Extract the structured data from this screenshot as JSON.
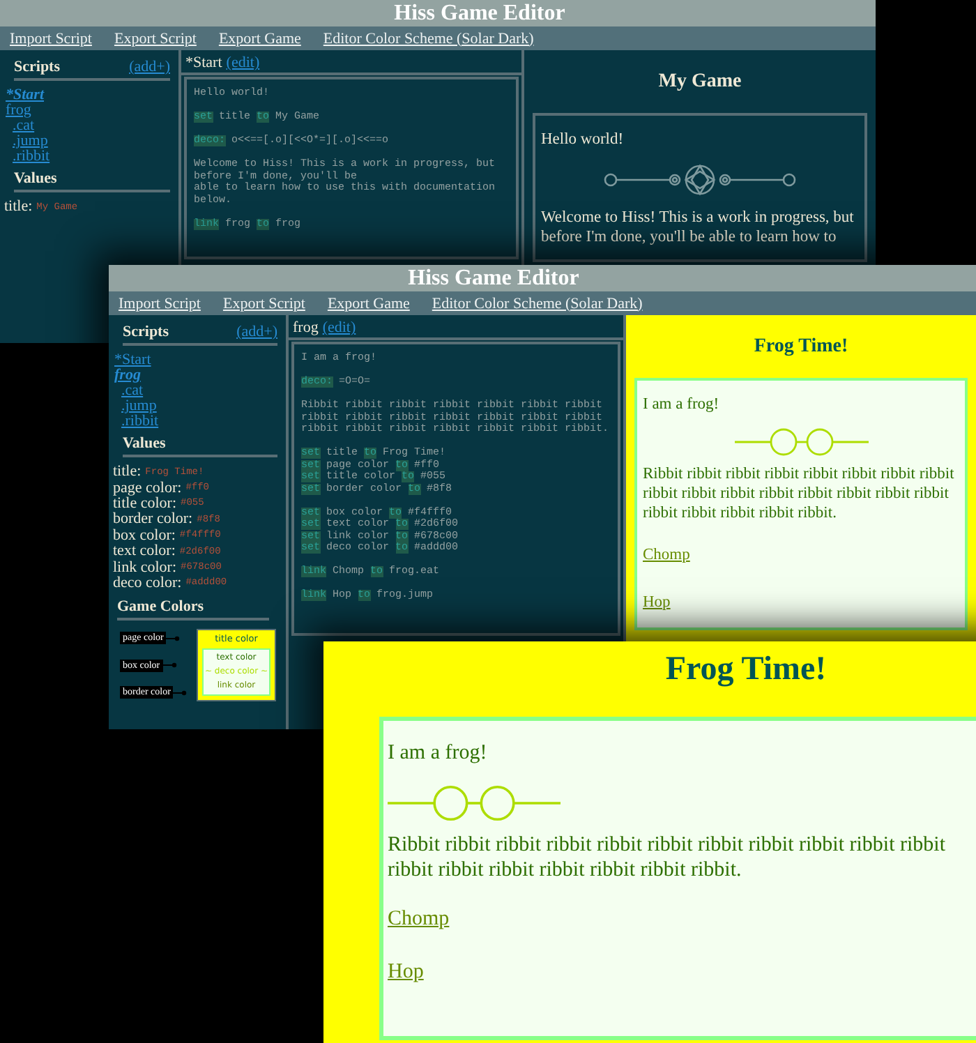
{
  "windows": [
    {
      "kind": "editor",
      "title": "Hiss Game Editor",
      "menu": [
        "Import Script",
        "Export Script",
        "Export Game",
        "Editor Color Scheme (Solar Dark)"
      ],
      "sidebar": {
        "scripts_header": "Scripts",
        "add_link": "(add+)",
        "scripts": [
          {
            "label": "*Start",
            "selected": true
          },
          {
            "label": "frog",
            "selected": false,
            "children": [
              {
                "label": ".cat",
                "selected": false
              },
              {
                "label": ".jump",
                "selected": false
              },
              {
                "label": ".ribbit",
                "selected": false
              }
            ]
          }
        ],
        "values_header": "Values",
        "values": [
          {
            "label": "title:",
            "value": "My Game"
          }
        ]
      },
      "editor": {
        "script_name": "*Start",
        "edit_link": "(edit)",
        "blocks": [
          [
            [
              {
                "text": "Hello world!",
                "keyword": false
              }
            ]
          ],
          [
            [
              {
                "text": "set",
                "keyword": true
              },
              {
                "text": " title ",
                "keyword": false
              },
              {
                "text": "to",
                "keyword": true
              },
              {
                "text": " My Game",
                "keyword": false
              }
            ]
          ],
          [
            [
              {
                "text": "deco:",
                "keyword": true
              },
              {
                "text": " o<<==[.o][<<O*=][.o]<<==o",
                "keyword": false
              }
            ]
          ],
          [
            [
              {
                "text": "Welcome to Hiss! This is a work in progress, but",
                "keyword": false
              }
            ],
            [
              {
                "text": "before I'm done, you'll be",
                "keyword": false
              }
            ],
            [
              {
                "text": "able to learn how to use this with documentation",
                "keyword": false
              }
            ],
            [
              {
                "text": "below.",
                "keyword": false
              }
            ]
          ],
          [
            [
              {
                "text": "link",
                "keyword": true
              },
              {
                "text": " frog ",
                "keyword": false
              },
              {
                "text": "to",
                "keyword": true
              },
              {
                "text": " frog",
                "keyword": false
              }
            ]
          ]
        ]
      },
      "preview": {
        "kind": "dark",
        "title": "My Game",
        "items": [
          {
            "kind": "text",
            "lines": [
              "Hello world!"
            ]
          },
          {
            "kind": "ornate-divider"
          },
          {
            "kind": "text",
            "lines": [
              "Welcome to Hiss! This is a work in progress, but",
              "before I'm done, you'll be able to learn how to"
            ]
          }
        ]
      }
    },
    {
      "kind": "editor",
      "title": "Hiss Game Editor",
      "menu": [
        "Import Script",
        "Export Script",
        "Export Game",
        "Editor Color Scheme (Solar Dark)"
      ],
      "sidebar": {
        "scripts_header": "Scripts",
        "add_link": "(add+)",
        "scripts": [
          {
            "label": "*Start",
            "selected": false
          },
          {
            "label": "frog",
            "selected": true,
            "children": [
              {
                "label": ".cat",
                "selected": false
              },
              {
                "label": ".jump",
                "selected": false
              },
              {
                "label": ".ribbit",
                "selected": false
              }
            ]
          }
        ],
        "values_header": "Values",
        "values": [
          {
            "label": "title:",
            "value": "Frog Time!"
          },
          {
            "label": "page color:",
            "value": "#ff0"
          },
          {
            "label": "title color:",
            "value": "#055"
          },
          {
            "label": "border color:",
            "value": "#8f8"
          },
          {
            "label": "box color:",
            "value": "#f4fff0"
          },
          {
            "label": "text color:",
            "value": "#2d6f00"
          },
          {
            "label": "link color:",
            "value": "#678c00"
          },
          {
            "label": "deco color:",
            "value": "#addd00"
          }
        ],
        "game_colors": {
          "title": "Game Colors",
          "callouts": [
            "page color",
            "box color",
            "border color"
          ],
          "title_sample": "title color",
          "samples": [
            "text color",
            "~ deco color ~",
            "link color"
          ]
        }
      },
      "editor": {
        "script_name": "frog",
        "edit_link": "(edit)",
        "blocks": [
          [
            [
              {
                "text": "I am a frog!",
                "keyword": false
              }
            ]
          ],
          [
            [
              {
                "text": "deco:",
                "keyword": true
              },
              {
                "text": " =O=O=",
                "keyword": false
              }
            ]
          ],
          [
            [
              {
                "text": "Ribbit ribbit ribbit ribbit ribbit ribbit ribbit",
                "keyword": false
              }
            ],
            [
              {
                "text": "ribbit ribbit ribbit ribbit ribbit ribbit ribbit",
                "keyword": false
              }
            ],
            [
              {
                "text": "ribbit ribbit ribbit ribbit ribbit ribbit ribbit.",
                "keyword": false
              }
            ]
          ],
          [
            [
              {
                "text": "set",
                "keyword": true
              },
              {
                "text": " title ",
                "keyword": false
              },
              {
                "text": "to",
                "keyword": true
              },
              {
                "text": " Frog Time!",
                "keyword": false
              }
            ],
            [
              {
                "text": "set",
                "keyword": true
              },
              {
                "text": " page color ",
                "keyword": false
              },
              {
                "text": "to",
                "keyword": true
              },
              {
                "text": " #ff0",
                "keyword": false
              }
            ],
            [
              {
                "text": "set",
                "keyword": true
              },
              {
                "text": " title color ",
                "keyword": false
              },
              {
                "text": "to",
                "keyword": true
              },
              {
                "text": " #055",
                "keyword": false
              }
            ],
            [
              {
                "text": "set",
                "keyword": true
              },
              {
                "text": " border color ",
                "keyword": false
              },
              {
                "text": "to",
                "keyword": true
              },
              {
                "text": " #8f8",
                "keyword": false
              }
            ]
          ],
          [
            [
              {
                "text": "set",
                "keyword": true
              },
              {
                "text": " box color ",
                "keyword": false
              },
              {
                "text": "to",
                "keyword": true
              },
              {
                "text": " #f4fff0",
                "keyword": false
              }
            ],
            [
              {
                "text": "set",
                "keyword": true
              },
              {
                "text": " text color ",
                "keyword": false
              },
              {
                "text": "to",
                "keyword": true
              },
              {
                "text": " #2d6f00",
                "keyword": false
              }
            ],
            [
              {
                "text": "set",
                "keyword": true
              },
              {
                "text": " link color ",
                "keyword": false
              },
              {
                "text": "to",
                "keyword": true
              },
              {
                "text": " #678c00",
                "keyword": false
              }
            ],
            [
              {
                "text": "set",
                "keyword": true
              },
              {
                "text": " deco color ",
                "keyword": false
              },
              {
                "text": "to",
                "keyword": true
              },
              {
                "text": " #addd00",
                "keyword": false
              }
            ]
          ],
          [
            [
              {
                "text": "link",
                "keyword": true
              },
              {
                "text": " Chomp ",
                "keyword": false
              },
              {
                "text": "to",
                "keyword": true
              },
              {
                "text": " frog.eat",
                "keyword": false
              }
            ]
          ],
          [
            [
              {
                "text": "link",
                "keyword": true
              },
              {
                "text": " Hop ",
                "keyword": false
              },
              {
                "text": "to",
                "keyword": true
              },
              {
                "text": " frog.jump",
                "keyword": false
              }
            ]
          ]
        ]
      },
      "preview": {
        "kind": "frog",
        "title": "Frog Time!",
        "items": [
          {
            "kind": "text",
            "lines": [
              "I am a frog!"
            ]
          },
          {
            "kind": "ring-divider"
          },
          {
            "kind": "text",
            "lines": [
              "Ribbit ribbit ribbit ribbit ribbit ribbit ribbit ribbit",
              "ribbit ribbit ribbit ribbit ribbit ribbit ribbit ribbit",
              "ribbit ribbit ribbit ribbit ribbit."
            ]
          },
          {
            "kind": "link",
            "label": "Chomp"
          },
          {
            "kind": "link",
            "label": "Hop"
          }
        ]
      }
    },
    {
      "kind": "game",
      "preview": {
        "kind": "frog",
        "title": "Frog Time!",
        "items": [
          {
            "kind": "text",
            "lines": [
              "I am a frog!"
            ]
          },
          {
            "kind": "ring-divider"
          },
          {
            "kind": "text",
            "lines": [
              "Ribbit ribbit ribbit ribbit ribbit ribbit ribbit ribbit ribbit ribbit ribbit",
              "ribbit ribbit ribbit ribbit ribbit ribbit ribbit."
            ]
          },
          {
            "kind": "link",
            "label": "Chomp"
          },
          {
            "kind": "link",
            "label": "Hop"
          }
        ]
      }
    }
  ]
}
